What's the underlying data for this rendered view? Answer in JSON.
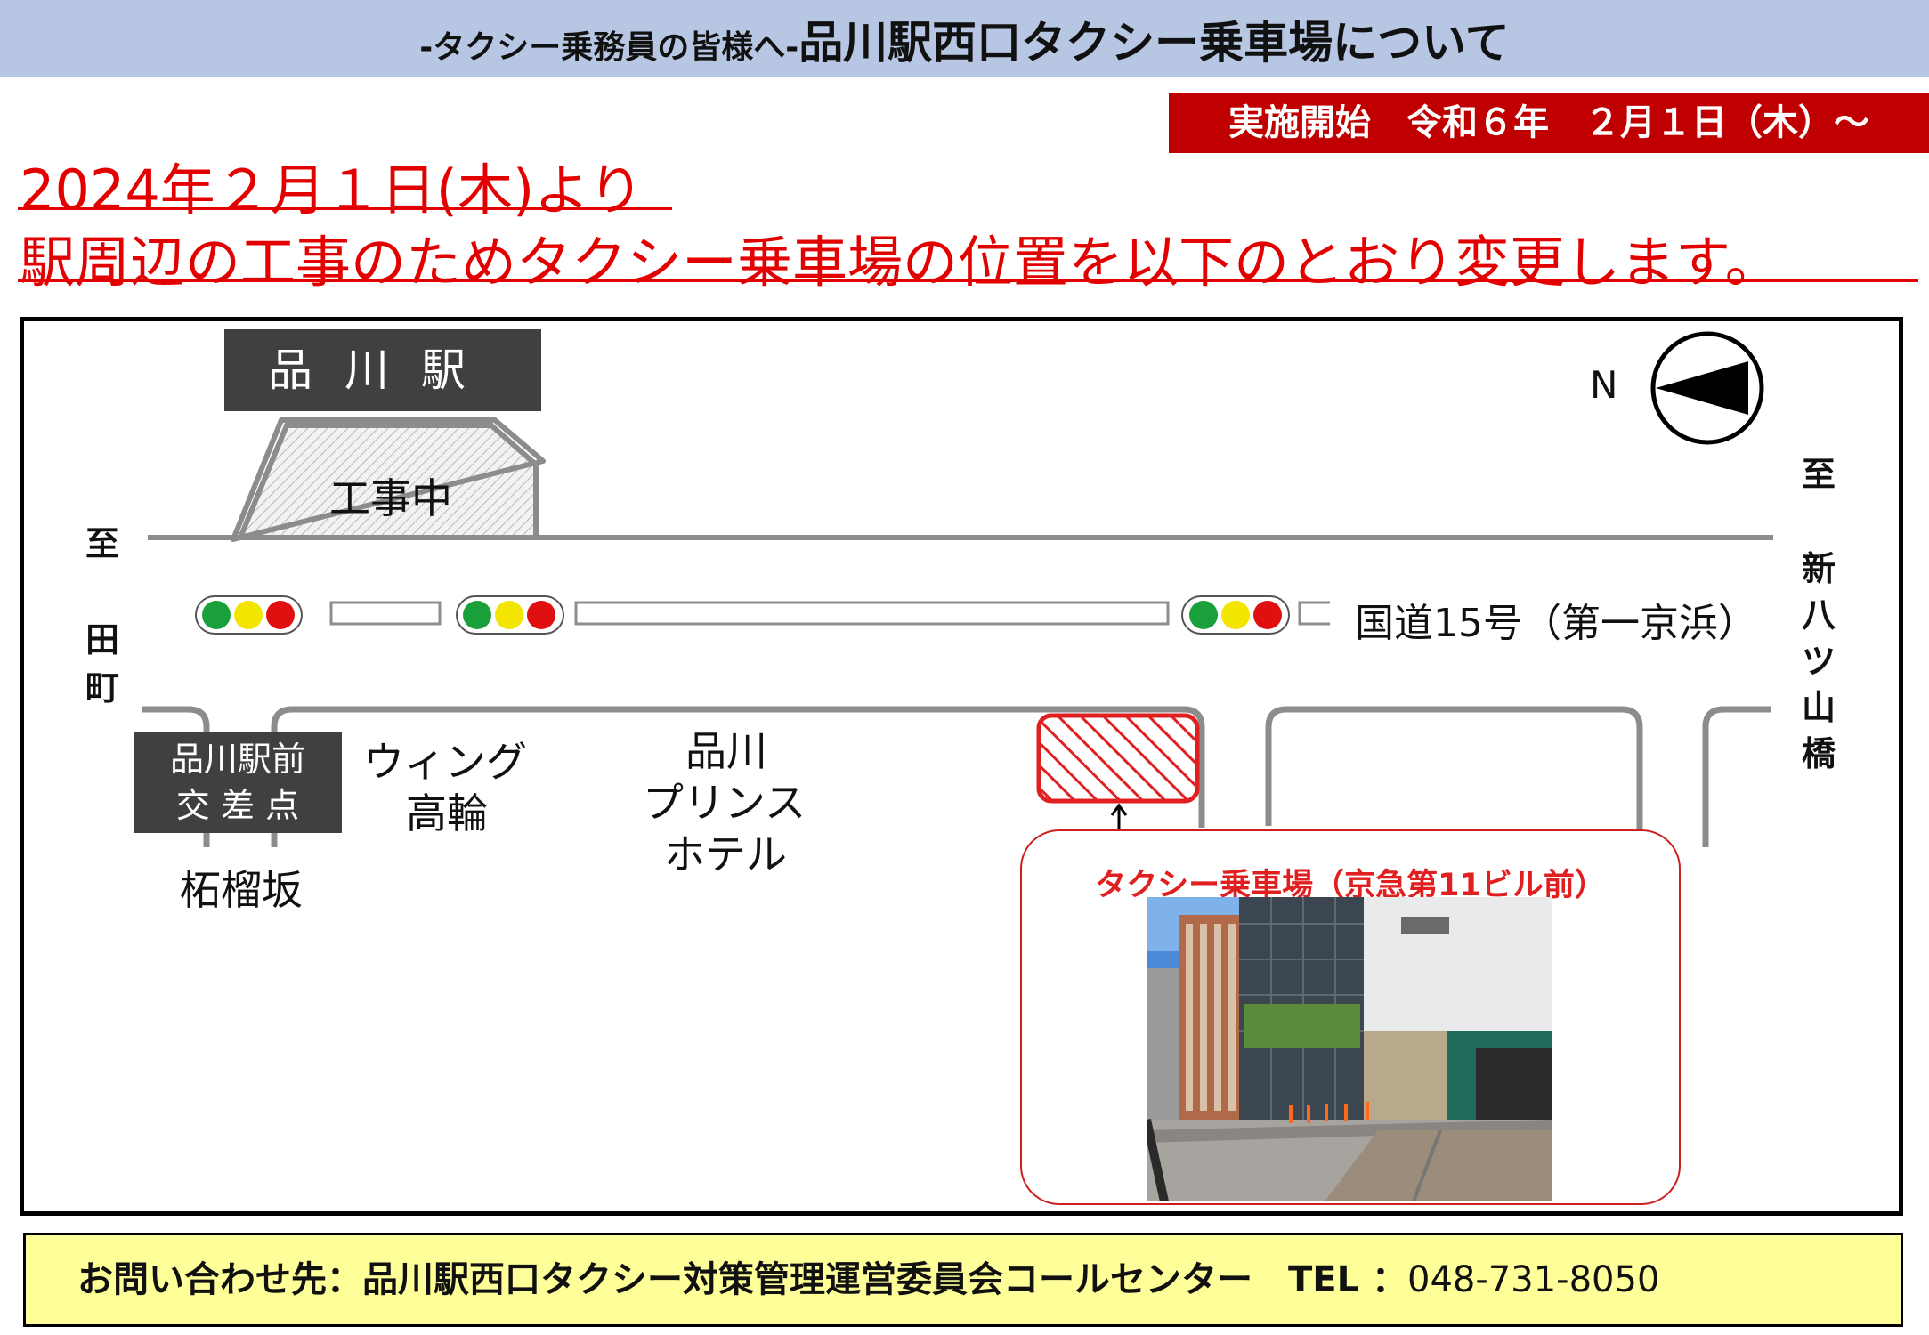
{
  "header": {
    "subtitle": "-タクシー乗務員の皆様へ-",
    "title": "品川駅西口タクシー乗車場について"
  },
  "start_badge": "実施開始　令和６年　２月１日（木）～",
  "notice": {
    "line1": "2024年２月１日(木)より",
    "line2": "駅周辺の工事のためタクシー乗車場の位置を以下のとおり変更します。"
  },
  "map": {
    "station_name": "品川駅",
    "construction": "工事中",
    "north": "N",
    "left_direction": [
      "至",
      "田",
      "町"
    ],
    "right_direction": [
      "至",
      "新",
      "八",
      "ツ",
      "山",
      "橋"
    ],
    "road_name": "国道15号（第一京浜）",
    "intersection": [
      "品川駅前",
      "交 差 点"
    ],
    "street": "柘榴坂",
    "buildings": [
      [
        "ウィング",
        "高輪"
      ],
      [
        "品川",
        "プリンス",
        "ホテル"
      ]
    ],
    "taxi_stand_caption": "タクシー乗車場（京急第11ビル前）",
    "colors": {
      "taxi_zone": "#e02020",
      "road": "#8c8c8c",
      "signal_green": "#1aa03a",
      "signal_yellow": "#f2e600",
      "signal_red": "#e01010"
    }
  },
  "footer": {
    "contact": "お問い合わせ先：品川駅西口タクシー対策管理運営委員会コールセンター",
    "tel_label": "TEL ：",
    "tel_number": "048-731-8050"
  }
}
